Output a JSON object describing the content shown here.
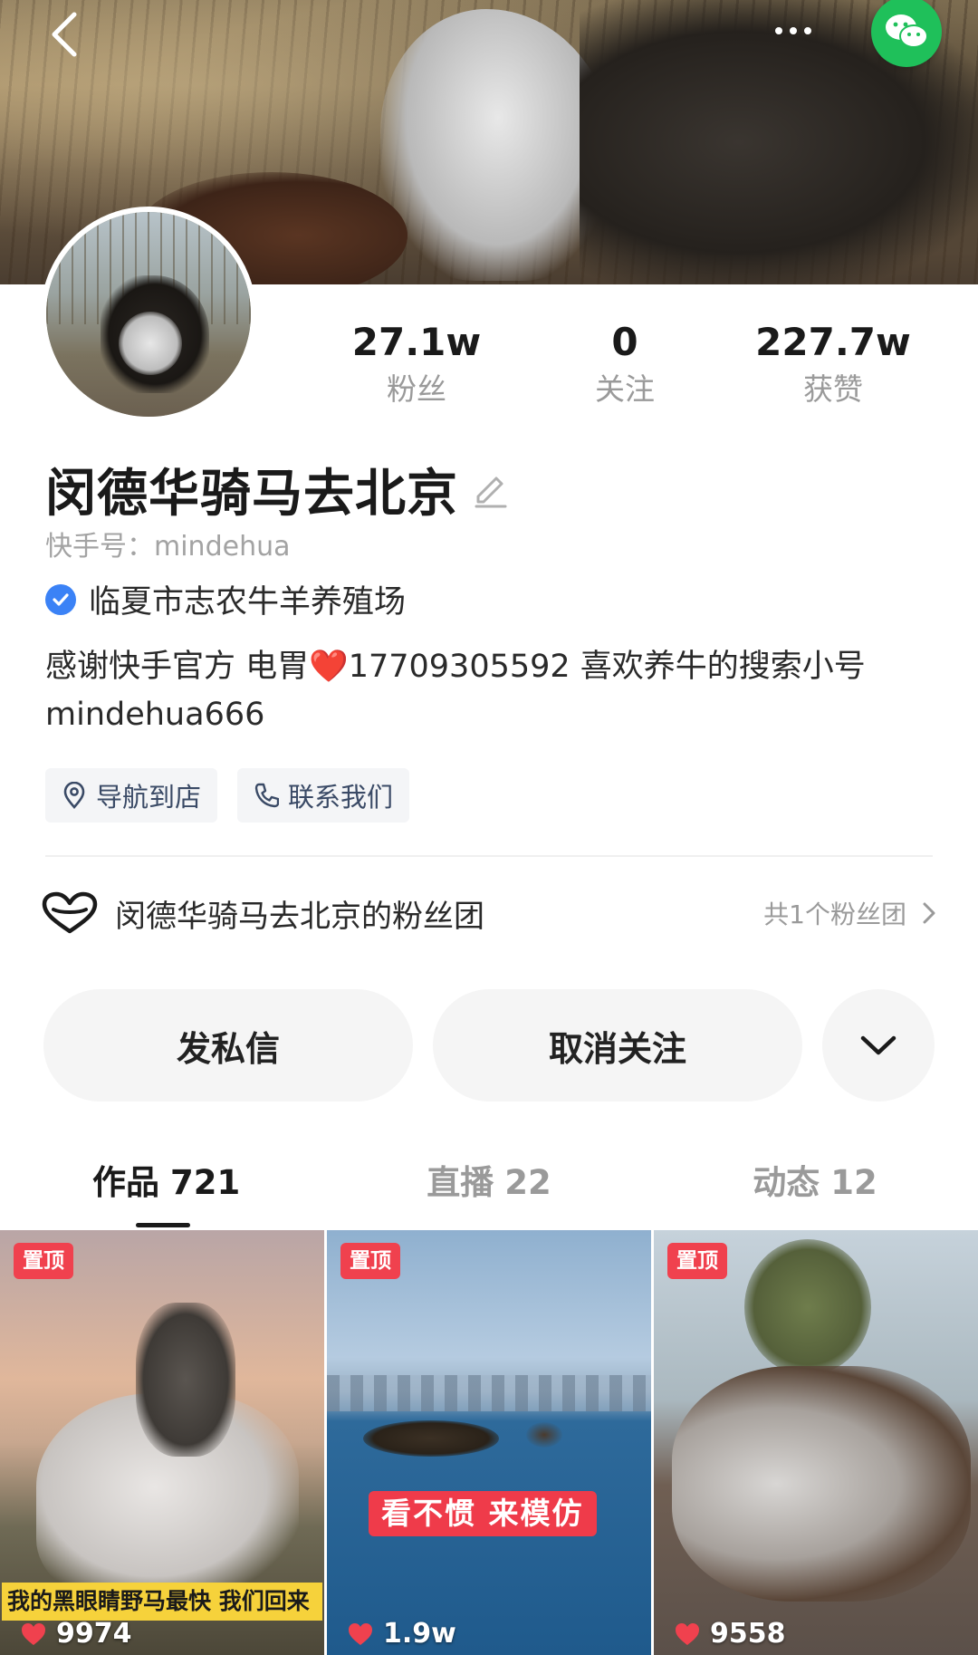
{
  "profile": {
    "name": "闵德华骑马去北京",
    "kuaishou_id": "快手号：mindehua",
    "verification": "临夏市志农牛羊养殖场",
    "bio_line1": "感谢快手官方 电胃❤️17709305592  喜欢养牛的搜索小号",
    "bio_line2": "mindehua666"
  },
  "stats": [
    {
      "value": "27.1w",
      "label": "粉丝"
    },
    {
      "value": "0",
      "label": "关注"
    },
    {
      "value": "227.7w",
      "label": "获赞"
    }
  ],
  "chips": {
    "navigate": "导航到店",
    "contact": "联系我们"
  },
  "fan_club": {
    "title": "闵德华骑马去北京的粉丝团",
    "count": "共1个粉丝团"
  },
  "actions": {
    "message": "发私信",
    "unfollow": "取消关注"
  },
  "tabs": [
    {
      "label": "作品",
      "count": "721"
    },
    {
      "label": "直播",
      "count": "22"
    },
    {
      "label": "动态",
      "count": "12"
    }
  ],
  "videos": [
    {
      "pin": "置顶",
      "caption": "我的黑眼睛野马最快 我们回来",
      "likes": "9974"
    },
    {
      "pin": "置顶",
      "caption": "看不惯 来模仿",
      "likes": "1.9w"
    },
    {
      "pin": "置顶",
      "caption": "",
      "likes": "9558"
    }
  ],
  "colors": {
    "accent_red": "#f0414e",
    "wechat_green": "#1fc05a",
    "verify_blue": "#3b82f6"
  }
}
